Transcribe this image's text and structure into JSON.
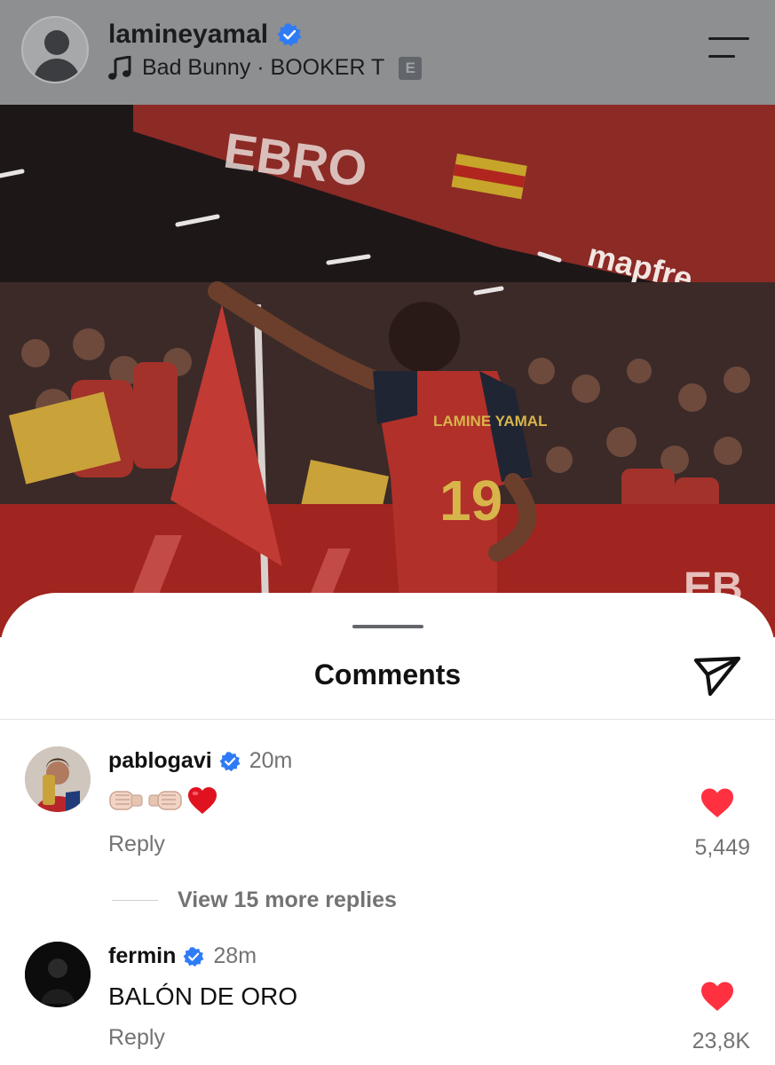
{
  "header": {
    "username": "lamineyamal",
    "music": "Bad Bunny · BOOKER T",
    "explicit_badge": "E"
  },
  "sheet": {
    "title": "Comments"
  },
  "comments": [
    {
      "user": "pablogavi",
      "time": "20m",
      "text": "👊🏻🤜🏻❤️",
      "reply_label": "Reply",
      "likes": "5,449",
      "view_more": "View 15 more replies"
    },
    {
      "user": "fermin",
      "time": "28m",
      "text": "BALÓN DE ORO",
      "reply_label": "Reply",
      "likes": "23,8K"
    }
  ],
  "photo": {
    "jersey_name": "LAMINE YAMAL",
    "jersey_number": "19",
    "banner_text": "mapfre"
  },
  "colors": {
    "header_bg": "#8e8f90",
    "verified_blue": "#2f7bf6",
    "like_red": "#ff3040",
    "muted_text": "#737373"
  }
}
